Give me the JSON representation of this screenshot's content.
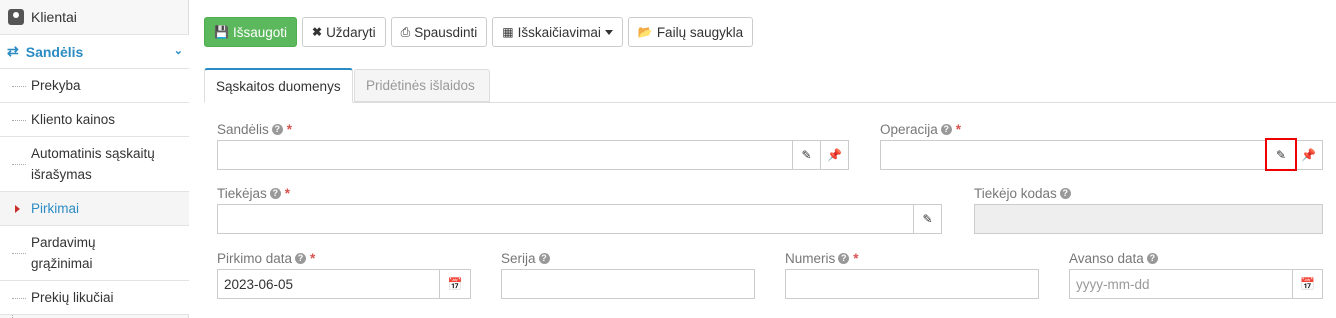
{
  "sidebar": {
    "top_item": "Klientai",
    "category": "Sandėlis",
    "items": [
      {
        "label": "Prekyba"
      },
      {
        "label": "Kliento kainos"
      },
      {
        "label_line1": "Automatinis sąskaitų",
        "label_line2": "išrašymas"
      },
      {
        "label": "Pirkimai"
      },
      {
        "label_line1": "Pardavimų",
        "label_line2": "grąžinimai"
      },
      {
        "label": "Prekių likučiai"
      }
    ]
  },
  "toolbar": {
    "save": "Išsaugoti",
    "close": "Uždaryti",
    "print": "Spausdinti",
    "calculations": "Išskaičiavimai",
    "files": "Failų saugykla"
  },
  "tabs": {
    "active": "Sąskaitos duomenys",
    "inactive": "Pridėtinės išlaidos"
  },
  "form": {
    "warehouse_label": "Sandėlis",
    "warehouse_value": "",
    "operation_label": "Operacija",
    "operation_value": "",
    "supplier_label": "Tiekėjas",
    "supplier_value": "",
    "supplier_code_label": "Tiekėjo kodas",
    "supplier_code_value": "",
    "purchase_date_label": "Pirkimo data",
    "purchase_date_value": "2023-06-05",
    "series_label": "Serija",
    "series_value": "",
    "number_label": "Numeris",
    "number_value": "",
    "advance_date_label": "Avanso data",
    "advance_date_placeholder": "yyyy-mm-dd"
  },
  "colors": {
    "accent": "#2b8cc4",
    "success": "#5cb85c",
    "required": "#d9534f",
    "highlight": "#e00000"
  },
  "icons": [
    "user-card-icon",
    "transfer-icon",
    "chevron-down-icon",
    "floppy-icon",
    "times-icon",
    "print-icon",
    "calculator-icon",
    "folder-open-icon",
    "help-icon",
    "pencil-icon",
    "pin-icon",
    "calendar-icon"
  ]
}
